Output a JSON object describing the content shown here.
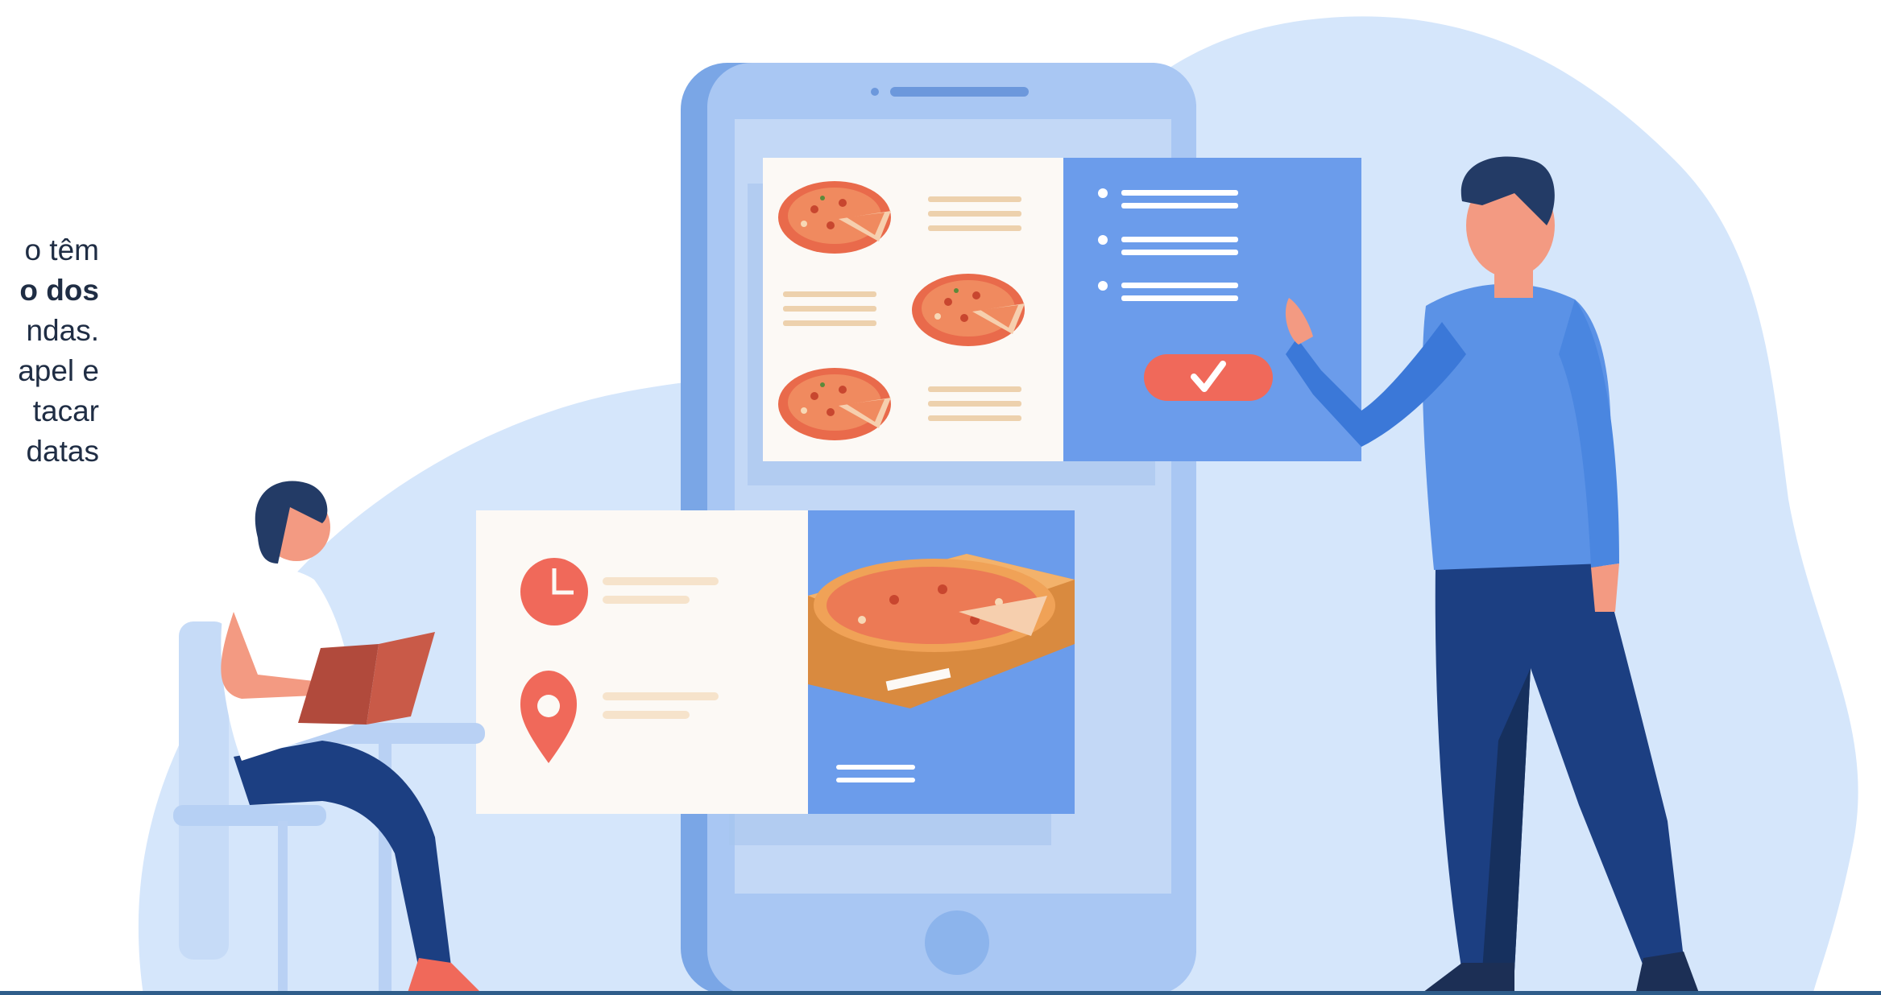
{
  "text_fragments": [
    {
      "text": "o  têm",
      "bold": false
    },
    {
      "text": "o dos",
      "bold": true
    },
    {
      "text": "ndas.",
      "bold": false
    },
    {
      "text": "apel e",
      "bold": false
    },
    {
      "text": "tacar",
      "bold": false
    },
    {
      "text": "datas",
      "bold": false
    }
  ],
  "illustration": {
    "name": "online pizza ordering illustration",
    "colors": {
      "background_blob": "#d5e6fb",
      "phone_body": "#a9c7f3",
      "phone_edge": "#7aa6e6",
      "phone_screen": "#c3d8f6",
      "card": "#fcf9f5",
      "card_blue": "#6b9ceb",
      "accent_red": "#f0695a",
      "menu_line": "#edd1ad",
      "pants_dark": "#1c3f82",
      "shirt_blue": "#5b92e6",
      "hair_dark": "#233b66",
      "skin": "#f39a82"
    },
    "icons": [
      "clock-icon",
      "location-pin-icon",
      "checkmark-icon",
      "pizza-icon",
      "pizza-box-icon",
      "menu-book-icon"
    ]
  }
}
